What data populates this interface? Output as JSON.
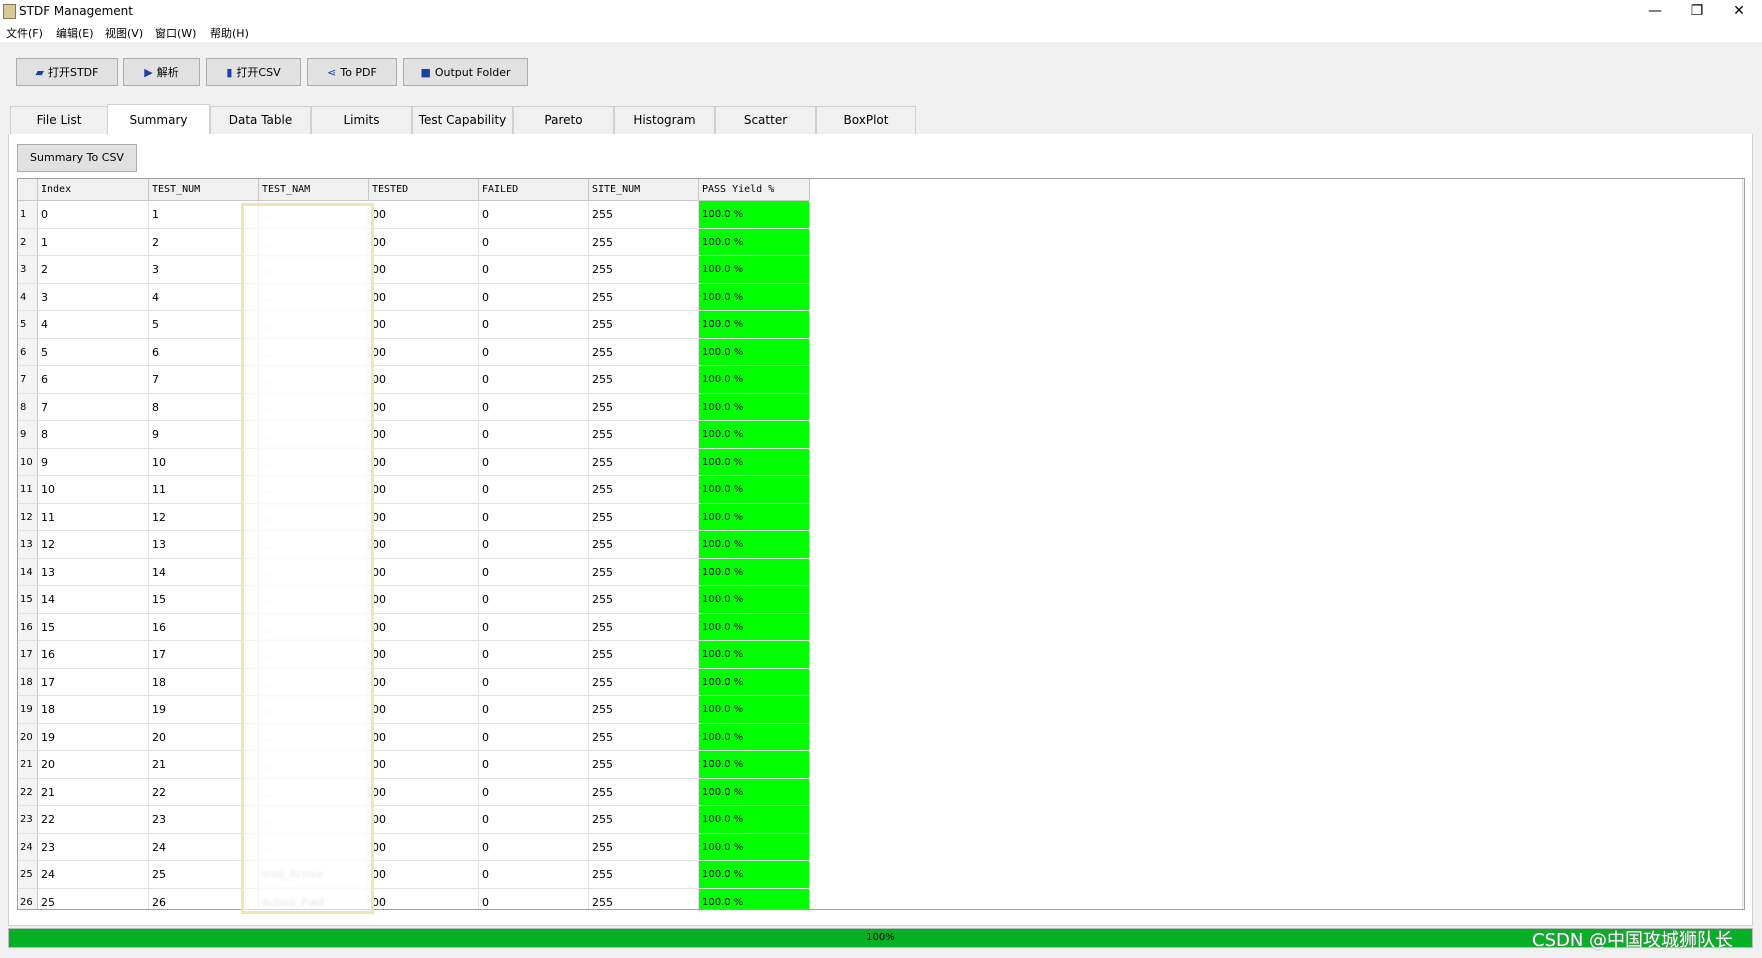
{
  "window": {
    "title": "STDF Management",
    "minimize_glyph": "—",
    "restore_glyph": "❐",
    "close_glyph": "✕"
  },
  "menu": [
    "文件(F)",
    "编辑(E)",
    "视图(V)",
    "窗口(W)",
    "帮助(H)"
  ],
  "toolbar": [
    {
      "label": "打开STDF",
      "icon": "folder-open-icon",
      "glyph": "▰"
    },
    {
      "label": "解析",
      "icon": "play-icon",
      "glyph": "▶"
    },
    {
      "label": "打开CSV",
      "icon": "file-icon",
      "glyph": "▮"
    },
    {
      "label": "To PDF",
      "icon": "share-icon",
      "glyph": "⋖"
    },
    {
      "label": "Output Folder",
      "icon": "folder-icon",
      "glyph": "■"
    }
  ],
  "tabs": [
    "File List",
    "Summary",
    "Data Table",
    "Limits",
    "Test Capability",
    "Pareto",
    "Histogram",
    "Scatter",
    "BoxPlot"
  ],
  "active_tab": "Summary",
  "summary_to_csv_label": "Summary To CSV",
  "table": {
    "columns": [
      "Index",
      "TEST_NUM",
      "TEST_NAM",
      "TESTED",
      "FAILED",
      "SITE_NUM",
      "PASS Yield %"
    ],
    "rows": [
      {
        "row": "1",
        "index": "0",
        "test_num": "1",
        "test_nam": "...",
        "tested": "00",
        "failed": "0",
        "site_num": "255",
        "yield": "100.0 %"
      },
      {
        "row": "2",
        "index": "1",
        "test_num": "2",
        "test_nam": "...",
        "tested": "00",
        "failed": "0",
        "site_num": "255",
        "yield": "100.0 %"
      },
      {
        "row": "3",
        "index": "2",
        "test_num": "3",
        "test_nam": "...",
        "tested": "00",
        "failed": "0",
        "site_num": "255",
        "yield": "100.0 %"
      },
      {
        "row": "4",
        "index": "3",
        "test_num": "4",
        "test_nam": "...",
        "tested": "00",
        "failed": "0",
        "site_num": "255",
        "yield": "100.0 %"
      },
      {
        "row": "5",
        "index": "4",
        "test_num": "5",
        "test_nam": "...",
        "tested": "00",
        "failed": "0",
        "site_num": "255",
        "yield": "100.0 %"
      },
      {
        "row": "6",
        "index": "5",
        "test_num": "6",
        "test_nam": "...",
        "tested": "00",
        "failed": "0",
        "site_num": "255",
        "yield": "100.0 %"
      },
      {
        "row": "7",
        "index": "6",
        "test_num": "7",
        "test_nam": "...",
        "tested": "00",
        "failed": "0",
        "site_num": "255",
        "yield": "100.0 %"
      },
      {
        "row": "8",
        "index": "7",
        "test_num": "8",
        "test_nam": "...",
        "tested": "00",
        "failed": "0",
        "site_num": "255",
        "yield": "100.0 %"
      },
      {
        "row": "9",
        "index": "8",
        "test_num": "9",
        "test_nam": "...",
        "tested": "00",
        "failed": "0",
        "site_num": "255",
        "yield": "100.0 %"
      },
      {
        "row": "10",
        "index": "9",
        "test_num": "10",
        "test_nam": "...",
        "tested": "00",
        "failed": "0",
        "site_num": "255",
        "yield": "100.0 %"
      },
      {
        "row": "11",
        "index": "10",
        "test_num": "11",
        "test_nam": "...",
        "tested": "00",
        "failed": "0",
        "site_num": "255",
        "yield": "100.0 %"
      },
      {
        "row": "12",
        "index": "11",
        "test_num": "12",
        "test_nam": "...",
        "tested": "00",
        "failed": "0",
        "site_num": "255",
        "yield": "100.0 %"
      },
      {
        "row": "13",
        "index": "12",
        "test_num": "13",
        "test_nam": "...",
        "tested": "00",
        "failed": "0",
        "site_num": "255",
        "yield": "100.0 %"
      },
      {
        "row": "14",
        "index": "13",
        "test_num": "14",
        "test_nam": "...",
        "tested": "00",
        "failed": "0",
        "site_num": "255",
        "yield": "100.0 %"
      },
      {
        "row": "15",
        "index": "14",
        "test_num": "15",
        "test_nam": "...",
        "tested": "00",
        "failed": "0",
        "site_num": "255",
        "yield": "100.0 %"
      },
      {
        "row": "16",
        "index": "15",
        "test_num": "16",
        "test_nam": "...",
        "tested": "00",
        "failed": "0",
        "site_num": "255",
        "yield": "100.0 %"
      },
      {
        "row": "17",
        "index": "16",
        "test_num": "17",
        "test_nam": "...",
        "tested": "00",
        "failed": "0",
        "site_num": "255",
        "yield": "100.0 %"
      },
      {
        "row": "18",
        "index": "17",
        "test_num": "18",
        "test_nam": "...",
        "tested": "00",
        "failed": "0",
        "site_num": "255",
        "yield": "100.0 %"
      },
      {
        "row": "19",
        "index": "18",
        "test_num": "19",
        "test_nam": "...",
        "tested": "00",
        "failed": "0",
        "site_num": "255",
        "yield": "100.0 %"
      },
      {
        "row": "20",
        "index": "19",
        "test_num": "20",
        "test_nam": "...",
        "tested": "00",
        "failed": "0",
        "site_num": "255",
        "yield": "100.0 %"
      },
      {
        "row": "21",
        "index": "20",
        "test_num": "21",
        "test_nam": "...",
        "tested": "00",
        "failed": "0",
        "site_num": "255",
        "yield": "100.0 %"
      },
      {
        "row": "22",
        "index": "21",
        "test_num": "22",
        "test_nam": "...",
        "tested": "00",
        "failed": "0",
        "site_num": "255",
        "yield": "100.0 %"
      },
      {
        "row": "23",
        "index": "22",
        "test_num": "23",
        "test_nam": "...",
        "tested": "00",
        "failed": "0",
        "site_num": "255",
        "yield": "100.0 %"
      },
      {
        "row": "24",
        "index": "23",
        "test_num": "24",
        "test_nam": "...",
        "tested": "00",
        "failed": "0",
        "site_num": "255",
        "yield": "100.0 %"
      },
      {
        "row": "25",
        "index": "24",
        "test_num": "25",
        "test_nam": "Vdd_Active",
        "tested": "00",
        "failed": "0",
        "site_num": "255",
        "yield": "100.0 %"
      },
      {
        "row": "26",
        "index": "25",
        "test_num": "26",
        "test_nam": "Active_Pwd",
        "tested": "00",
        "failed": "0",
        "site_num": "255",
        "yield": "100.0 %"
      }
    ]
  },
  "colors": {
    "pass_fill": "#00ff00",
    "progress_fill": "#06b025"
  },
  "progress": {
    "value": 100,
    "label": "100%"
  },
  "watermark": "CSDN @中国攻城狮队长"
}
